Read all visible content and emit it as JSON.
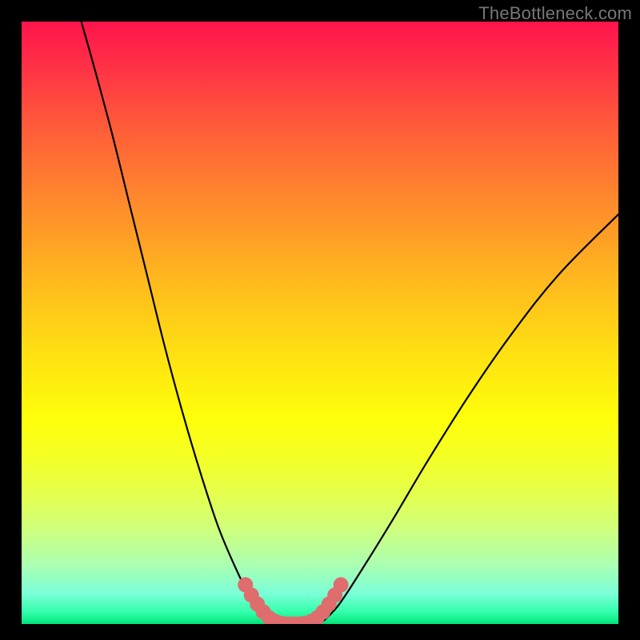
{
  "watermark": "TheBottleneck.com",
  "colors": {
    "background": "#000000",
    "curve": "#000000",
    "marker": "#e06d6d",
    "gradient_top": "#ff144d",
    "gradient_bottom": "#00e57a"
  },
  "chart_data": {
    "type": "line",
    "title": "",
    "xlabel": "",
    "ylabel": "",
    "xlim": [
      0,
      100
    ],
    "ylim": [
      0,
      100
    ],
    "grid": false,
    "series": [
      {
        "name": "left-curve",
        "x": [
          10,
          12,
          15,
          18,
          21,
          24,
          27,
          30,
          33,
          36,
          39,
          41
        ],
        "y": [
          100,
          93,
          82,
          70,
          58,
          46,
          35,
          25,
          16,
          9,
          3,
          0
        ]
      },
      {
        "name": "valley-floor",
        "x": [
          41,
          44,
          47,
          50
        ],
        "y": [
          0,
          0,
          0,
          0
        ]
      },
      {
        "name": "right-curve",
        "x": [
          50,
          53,
          57,
          62,
          68,
          75,
          82,
          90,
          100
        ],
        "y": [
          0,
          3,
          9,
          17,
          27,
          38,
          48,
          58,
          68
        ]
      }
    ],
    "markers": {
      "name": "highlighted-valley",
      "x": [
        37.5,
        38.5,
        39.5,
        40.5,
        41.5,
        42.5,
        43.5,
        44.5,
        45.5,
        46.5,
        47.5,
        48.5,
        49.5,
        50.5,
        51.5,
        52.5,
        53.5
      ],
      "y": [
        6.5,
        4.8,
        3.3,
        2.0,
        1.0,
        0.4,
        0.1,
        0.0,
        0.0,
        0.0,
        0.1,
        0.4,
        1.0,
        2.0,
        3.3,
        4.8,
        6.5
      ]
    }
  }
}
